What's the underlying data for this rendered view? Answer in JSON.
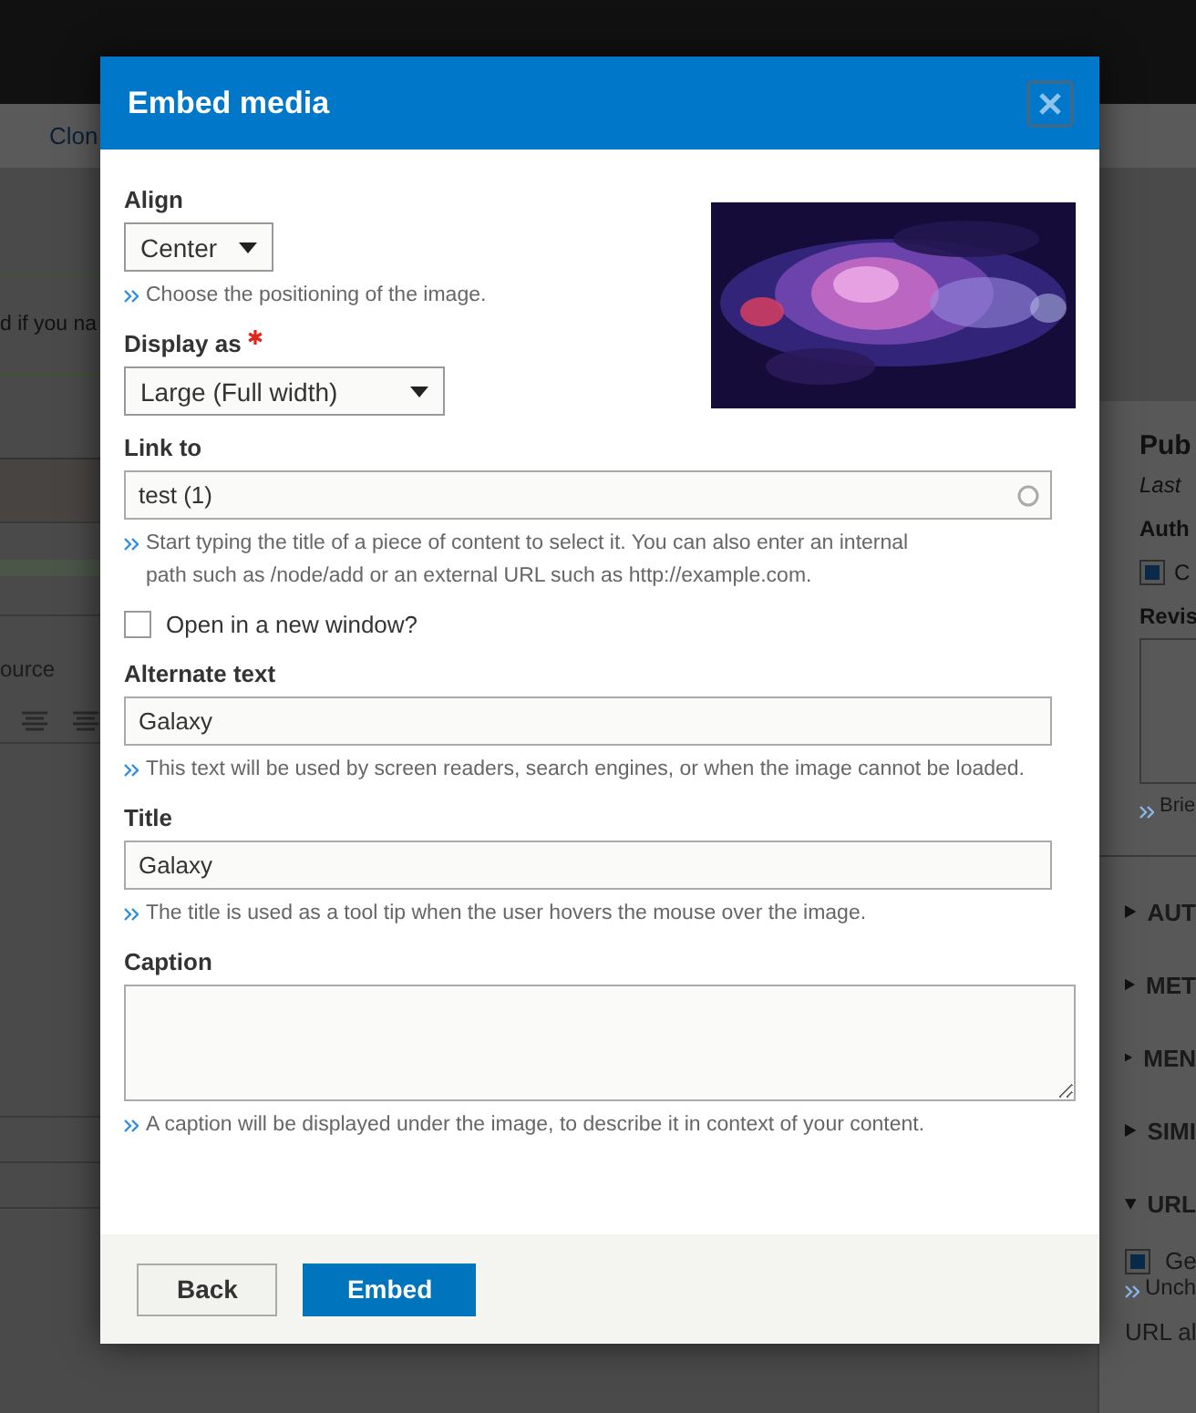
{
  "page": {
    "toolbar_link": "Clon",
    "message": "d if you na",
    "editor_button": "ource",
    "sidebar": {
      "heading": "Pub",
      "meta": "Last",
      "author_label": "Auth",
      "author_checkbox": {
        "label": "C",
        "checked": true
      },
      "revision_label": "Revis",
      "revision_help": "Brie",
      "sections": [
        {
          "label": "AUT",
          "expanded": false
        },
        {
          "label": "MET",
          "expanded": false
        },
        {
          "label": "MEN",
          "expanded": false
        },
        {
          "label": "SIMI",
          "expanded": false
        },
        {
          "label": "URL",
          "expanded": true
        }
      ],
      "url_checkbox": {
        "label": "Ge",
        "checked": true
      },
      "url_help": "Unch",
      "url_alias_label": "URL al"
    }
  },
  "dialog": {
    "title": "Embed media",
    "fields": [
      {
        "kind": "select",
        "label": "Align",
        "value": "Center",
        "help": "Choose the positioning of the image."
      },
      {
        "kind": "select",
        "label": "Display as",
        "required": true,
        "value": "Large (Full width)"
      },
      {
        "kind": "autocomplete",
        "label": "Link to",
        "value": "test (1)",
        "help": "Start typing the title of a piece of content to select it. You can also enter an internal path such as /node/add or an external URL such as http://example.com."
      },
      {
        "kind": "checkbox",
        "label": "Open in a new window?",
        "checked": false
      },
      {
        "kind": "text",
        "label": "Alternate text",
        "value": "Galaxy",
        "help": "This text will be used by screen readers, search engines, or when the image cannot be loaded."
      },
      {
        "kind": "text",
        "label": "Title",
        "value": "Galaxy",
        "help": "The title is used as a tool tip when the user hovers the mouse over the image."
      },
      {
        "kind": "textarea",
        "label": "Caption",
        "help": "A caption will be displayed under the image, to describe it in context of your content."
      }
    ],
    "buttons": [
      {
        "label": "Back",
        "primary": false
      },
      {
        "label": "Embed",
        "primary": true
      }
    ]
  }
}
